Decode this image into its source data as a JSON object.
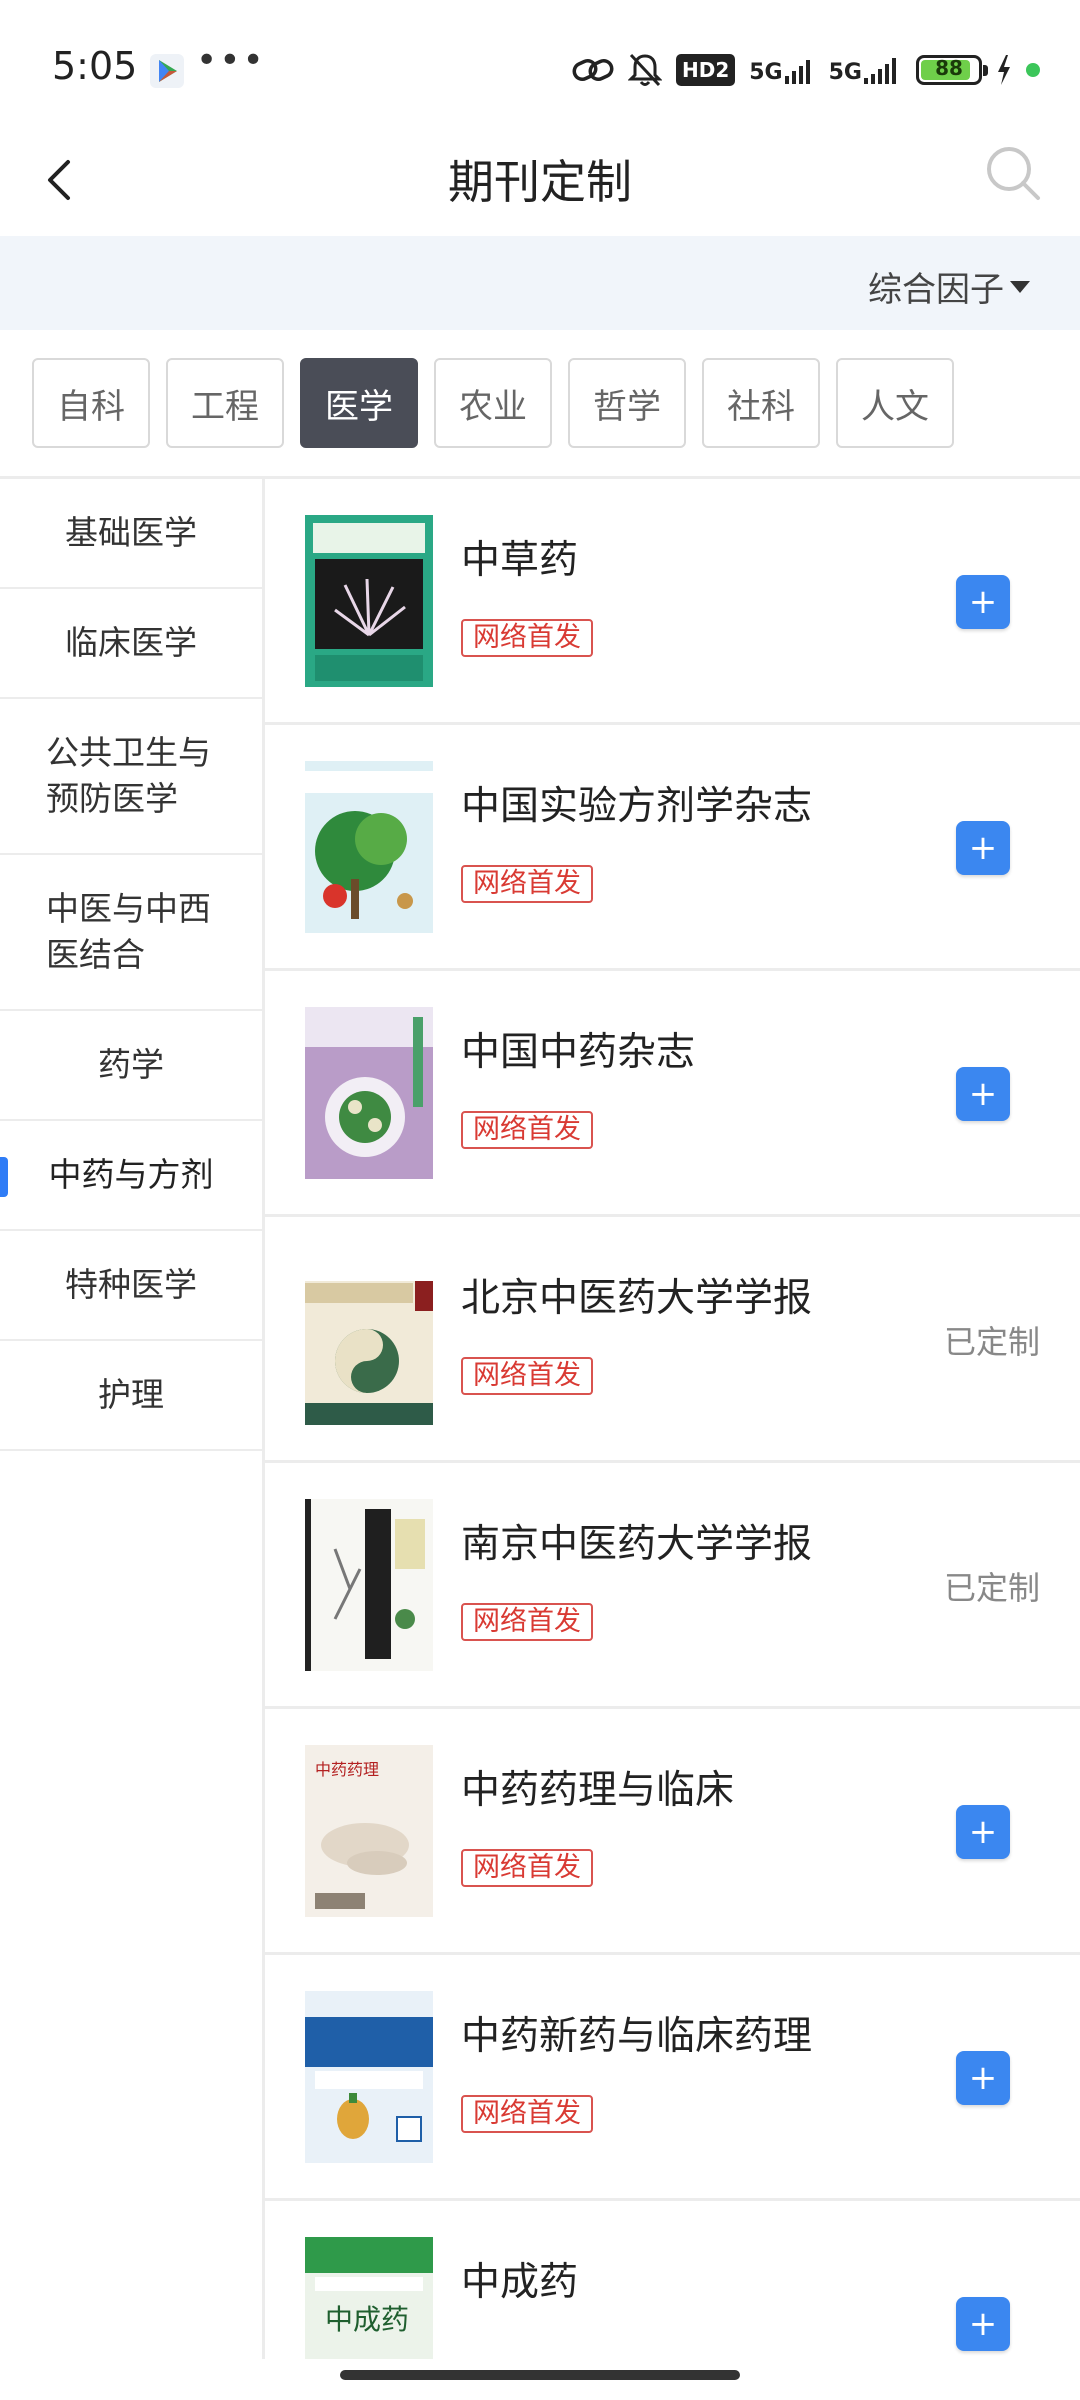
{
  "status_bar": {
    "time": "5:05",
    "net1": "5G",
    "net2": "5G",
    "hd": "HD2",
    "battery": "88",
    "icons": [
      "play-store-icon",
      "more-icon",
      "link-icon",
      "mute-icon",
      "hd-icon",
      "signal-icon",
      "signal-icon",
      "battery-icon",
      "charging-icon",
      "dot-icon"
    ]
  },
  "header": {
    "title": "期刊定制",
    "back_icon": "chevron-left-icon",
    "search_icon": "search-icon"
  },
  "sort": {
    "label": "综合因子"
  },
  "categories": [
    {
      "label": "自科",
      "active": false
    },
    {
      "label": "工程",
      "active": false
    },
    {
      "label": "医学",
      "active": true
    },
    {
      "label": "农业",
      "active": false
    },
    {
      "label": "哲学",
      "active": false
    },
    {
      "label": "社科",
      "active": false
    },
    {
      "label": "人文",
      "active": false
    }
  ],
  "sidebar": {
    "items": [
      {
        "label": "基础医学"
      },
      {
        "label": "临床医学"
      },
      {
        "label": "公共卫生与",
        "label2": "预防医学"
      },
      {
        "label": "中医与中西",
        "label2": "医结合"
      },
      {
        "label": "药学"
      },
      {
        "label": "中药与方剂",
        "active": true
      },
      {
        "label": "特种医学"
      },
      {
        "label": "护理"
      }
    ]
  },
  "journals": [
    {
      "title": "中草药",
      "badge": "网络首发",
      "action": "+",
      "status": ""
    },
    {
      "title": "中国实验方剂学杂志",
      "badge": "网络首发",
      "action": "+",
      "status": ""
    },
    {
      "title": "中国中药杂志",
      "badge": "网络首发",
      "action": "+",
      "status": ""
    },
    {
      "title": "北京中医药大学学报",
      "badge": "网络首发",
      "action": "",
      "status": "已定制"
    },
    {
      "title": "南京中医药大学学报",
      "badge": "网络首发",
      "action": "",
      "status": "已定制"
    },
    {
      "title": "中药药理与临床",
      "badge": "网络首发",
      "action": "+",
      "status": ""
    },
    {
      "title": "中药新药与临床药理",
      "badge": "网络首发",
      "action": "+",
      "status": ""
    },
    {
      "title": "中成药",
      "badge": "",
      "action": "+",
      "status": ""
    }
  ],
  "colors": {
    "accent": "#3b87f0",
    "active_tab": "#4a4d57",
    "badge_red": "#d93a33",
    "sort_bg": "#f1f5fa"
  }
}
